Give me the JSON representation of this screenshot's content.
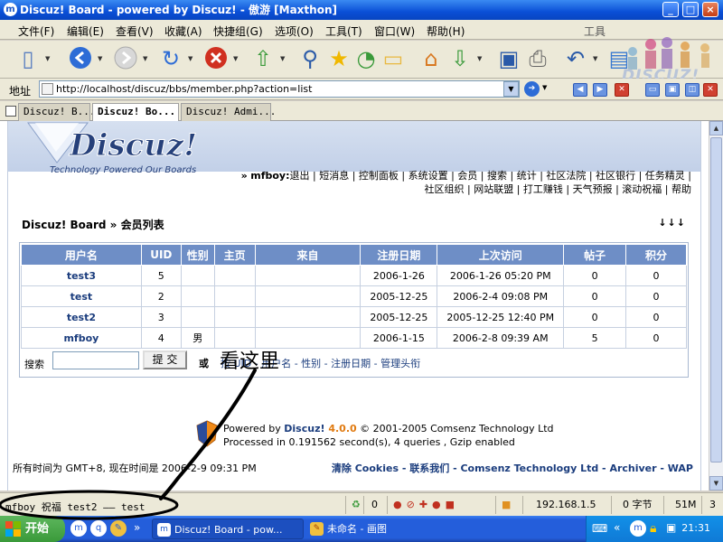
{
  "window": {
    "title": "Discuz! Board - powered by Discuz! - 傲游 [Maxthon]",
    "controls": [
      "_",
      "□",
      "×"
    ],
    "brand": "DISCUZ!"
  },
  "menu": {
    "items": [
      "文件(F)",
      "编辑(E)",
      "查看(V)",
      "收藏(A)",
      "快捷组(G)",
      "选项(O)",
      "工具(T)",
      "窗口(W)",
      "帮助(H)"
    ],
    "tools_label": "工具"
  },
  "toolbar": {
    "buttons": [
      "new-window",
      "back",
      "forward",
      "refresh",
      "stop",
      "home-up",
      "search",
      "favorites",
      "history",
      "folder",
      "home",
      "download",
      "save",
      "print",
      "undo",
      "window"
    ]
  },
  "address": {
    "label": "地址",
    "url": "http://localhost/discuz/bbs/member.php?action=list"
  },
  "tabs": [
    {
      "label": "Discuz! B...",
      "active": false
    },
    {
      "label": "Discuz! Bo...",
      "active": true
    },
    {
      "label": "Discuz! Admi...",
      "active": false
    }
  ],
  "forum": {
    "logo_text": "Discuz!",
    "logo_tagline": "Technology Powered Our Boards",
    "user_prefix": "»",
    "user": "mfboy:",
    "links_line1": "退出 | 短消息 | 控制面板 | 系统设置 | 会员 | 搜索 | 统计 | 社区法院 | 社区银行 | 任务精灵 |",
    "links_line2": "社区组织 | 网站联盟 | 打工赚钱 | 天气预报 | 滚动祝福 | 帮助",
    "breadcrumb": "Discuz! Board » 会员列表",
    "nav_arrows": "↓↓↓",
    "table": {
      "headers": [
        "用户名",
        "UID",
        "性别",
        "主页",
        "来自",
        "注册日期",
        "上次访问",
        "帖子",
        "积分"
      ],
      "rows": [
        [
          "test3",
          "5",
          "",
          "",
          "",
          "2006-1-26",
          "2006-1-26 05:20 PM",
          "0",
          "0"
        ],
        [
          "test",
          "2",
          "",
          "",
          "",
          "2005-12-25",
          "2006-2-4 09:08 PM",
          "0",
          "0"
        ],
        [
          "test2",
          "3",
          "",
          "",
          "",
          "2005-12-25",
          "2005-12-25 12:40 PM",
          "0",
          "0"
        ],
        [
          "mfboy",
          "4",
          "男",
          "",
          "",
          "2006-1-15",
          "2006-2-8 09:39 AM",
          "5",
          "0"
        ]
      ]
    },
    "search": {
      "label": "搜索",
      "button": "提 交",
      "or_label": "或",
      "sort_links": "按 UID - 用户名 - 性别 - 注册日期 - 管理头衔"
    },
    "footer": {
      "powered_prefix": "Powered by ",
      "product": "Discuz!",
      "version": " 4.0.0",
      "copyright": " © 2001-2005 Comsenz Technology Ltd",
      "processed": "Processed in 0.191562 second(s), 4 queries , Gzip enabled",
      "time_line": "所有时间为  GMT+8, 现在时间是  2006-2-9 09:31 PM",
      "links": "清除  Cookies - 联系我们 - Comsenz Technology Ltd - Archiver - WAP"
    }
  },
  "annotation": {
    "text": "看这里"
  },
  "statusbar": {
    "text": "mfboy 祝福 test2 —— test",
    "count": "0",
    "ip": "192.168.1.5",
    "bytes": "0 字节",
    "memory": "51M",
    "windows": "3"
  },
  "taskbar": {
    "start": "开始",
    "tasks": [
      {
        "label": "Discuz! Board - pow...",
        "active": true
      },
      {
        "label": "未命名 - 画图",
        "active": false
      }
    ],
    "clock": "21:31",
    "tray_chevron": "«"
  },
  "colors": {
    "title_bar": "#0a4fd6",
    "table_header": "#6e8ec6",
    "link": "#1a3c7d",
    "taskbar": "#245edb",
    "start": "#3a9a3a"
  }
}
